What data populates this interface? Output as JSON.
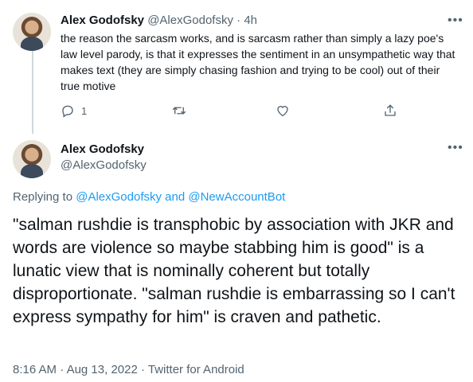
{
  "tweet1": {
    "display_name": "Alex Godofsky",
    "handle": "@AlexGodofsky",
    "separator": "·",
    "time": "4h",
    "text": "the reason the sarcasm works, and is sarcasm rather than simply a lazy poe's law level parody, is that it expresses the sentiment in an unsympathetic way that makes text (they are simply chasing fashion and trying to be cool) out of their true motive",
    "reply_count": "1",
    "retweet_count": "",
    "like_count": ""
  },
  "tweet2": {
    "display_name": "Alex Godofsky",
    "handle": "@AlexGodofsky",
    "replying_prefix": "Replying to ",
    "replying_mention_1": "@AlexGodofsky",
    "replying_and": " and ",
    "replying_mention_2": "@NewAccountBot",
    "text": "\"salman rushdie is transphobic by association with JKR and words are violence so maybe stabbing him is good\" is a lunatic view that is nominally coherent but totally disproportionate. \"salman rushdie is embarrassing so I can't express sympathy for him\" is craven and pathetic.",
    "time": "8:16 AM",
    "separator": " · ",
    "date": "Aug 13, 2022",
    "source": "Twitter for Android"
  },
  "icons": {
    "more": "more-icon",
    "reply": "reply-icon",
    "retweet": "retweet-icon",
    "like": "heart-icon",
    "share": "share-icon"
  },
  "colors": {
    "text": "#0f1419",
    "secondary": "#536471",
    "link": "#1d9bf0",
    "thread_line": "#cfd9de"
  }
}
